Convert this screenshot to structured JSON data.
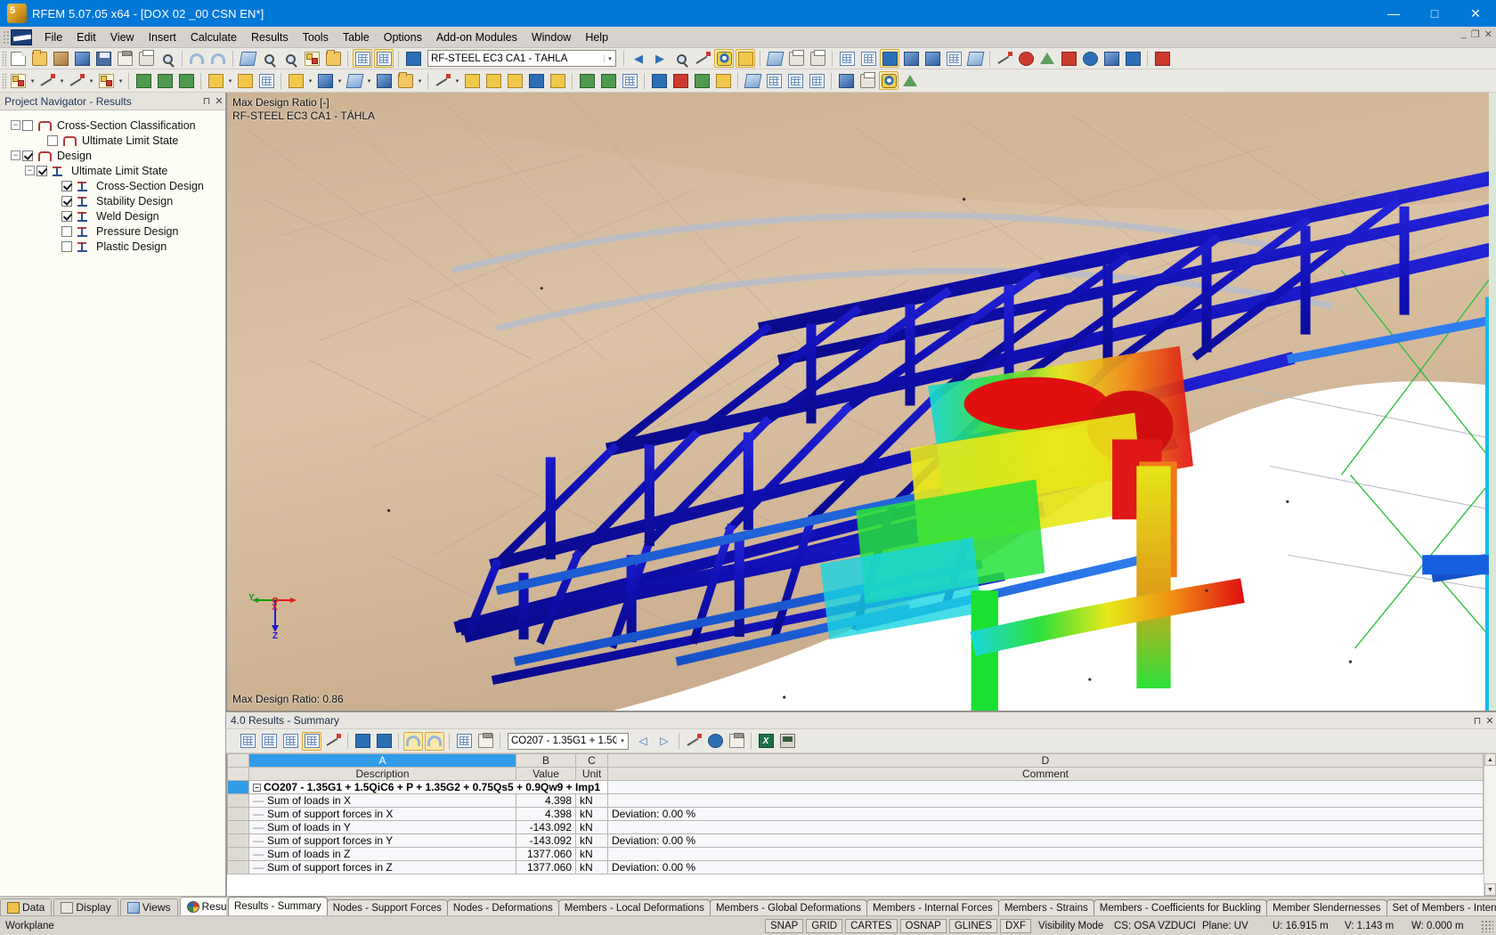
{
  "window": {
    "title": "RFEM 5.07.05 x64 - [DOX 02 _00 CSN EN*]",
    "minimize": "—",
    "maximize": "□",
    "close": "✕",
    "mdi_minimize": "_",
    "mdi_restore": "❐",
    "mdi_close": "✕"
  },
  "menu": [
    {
      "label": "File"
    },
    {
      "label": "Edit"
    },
    {
      "label": "View"
    },
    {
      "label": "Insert"
    },
    {
      "label": "Calculate"
    },
    {
      "label": "Results"
    },
    {
      "label": "Tools"
    },
    {
      "label": "Table"
    },
    {
      "label": "Options"
    },
    {
      "label": "Add-on Modules"
    },
    {
      "label": "Window"
    },
    {
      "label": "Help"
    }
  ],
  "toolbar": {
    "module_combo_value": "RF-STEEL EC3 CA1 - TÁHLA",
    "module_combo_arrow": "▾"
  },
  "navigator": {
    "title": "Project Navigator - Results",
    "pin": "⊓",
    "close": "✕",
    "tree": [
      {
        "label": "Cross-Section Classification",
        "checked": false,
        "icon": "cross-section-icon",
        "level": 0,
        "expander": "−"
      },
      {
        "label": "Ultimate Limit State",
        "checked": false,
        "icon": "cross-section-icon",
        "level": 1,
        "expander": ""
      },
      {
        "label": "Design",
        "checked": true,
        "icon": "cross-section-icon",
        "level": 0,
        "expander": "−"
      },
      {
        "label": "Ultimate Limit State",
        "checked": true,
        "icon": "ibeam-icon",
        "level": 1,
        "expander": "−"
      },
      {
        "label": "Cross-Section Design",
        "checked": true,
        "icon": "ibeam-icon",
        "level": 2,
        "expander": ""
      },
      {
        "label": "Stability Design",
        "checked": true,
        "icon": "ibeam-icon",
        "level": 2,
        "expander": ""
      },
      {
        "label": "Weld Design",
        "checked": true,
        "icon": "ibeam-icon",
        "level": 2,
        "expander": ""
      },
      {
        "label": "Pressure Design",
        "checked": false,
        "icon": "ibeam-icon",
        "level": 2,
        "expander": ""
      },
      {
        "label": "Plastic Design",
        "checked": false,
        "icon": "ibeam-icon",
        "level": 2,
        "expander": ""
      }
    ],
    "tabs": [
      {
        "label": "Data",
        "active": false,
        "icon": "data-icon"
      },
      {
        "label": "Display",
        "active": false,
        "icon": "display-icon"
      },
      {
        "label": "Views",
        "active": false,
        "icon": "views-icon"
      },
      {
        "label": "Results",
        "active": true,
        "icon": "results-icon"
      }
    ]
  },
  "viewport": {
    "label_line1": "Max Design Ratio [-]",
    "label_line2": "RF-STEEL EC3 CA1 - TÁHLA",
    "footer": "Max Design Ratio: 0.86",
    "axis_x": "X",
    "axis_y": "Y",
    "axis_z": "Z",
    "axis_x_color": "#e01b1b",
    "axis_y_color": "#09a009",
    "axis_z_color": "#1a1ad0"
  },
  "results_panel": {
    "title": "4.0 Results - Summary",
    "pin": "⊓",
    "close": "✕",
    "combo_value": "CO207 - 1.35G1 + 1.5C",
    "combo_arrow": "▾",
    "prev_arrow": "◁",
    "next_arrow": "▷",
    "columns": [
      {
        "letter": "A",
        "name": "Description",
        "selected": true
      },
      {
        "letter": "B",
        "name": "Value",
        "selected": false
      },
      {
        "letter": "C",
        "name": "Unit",
        "selected": false
      },
      {
        "letter": "D",
        "name": "Comment",
        "selected": false
      }
    ],
    "rows": [
      {
        "type": "group",
        "description": "CO207 - 1.35G1 + 1.5QiC6 + P + 1.35G2 + 0.75Qs5 + 0.9Qw9 + Imp1",
        "value": "",
        "unit": "",
        "comment": "",
        "expander": "−",
        "selected": true
      },
      {
        "type": "item",
        "description": "Sum of loads in X",
        "value": "4.398",
        "unit": "kN",
        "comment": ""
      },
      {
        "type": "item",
        "description": "Sum of support forces in X",
        "value": "4.398",
        "unit": "kN",
        "comment": "Deviation:  0.00 %"
      },
      {
        "type": "item",
        "description": "Sum of loads in Y",
        "value": "-143.092",
        "unit": "kN",
        "comment": ""
      },
      {
        "type": "item",
        "description": "Sum of support forces in Y",
        "value": "-143.092",
        "unit": "kN",
        "comment": "Deviation:  0.00 %"
      },
      {
        "type": "item",
        "description": "Sum of loads in Z",
        "value": "1377.060",
        "unit": "kN",
        "comment": ""
      },
      {
        "type": "item",
        "description": "Sum of support forces in Z",
        "value": "1377.060",
        "unit": "kN",
        "comment": "Deviation:  0.00 %"
      }
    ],
    "tabs": [
      {
        "label": "Results - Summary",
        "active": true
      },
      {
        "label": "Nodes - Support Forces",
        "active": false
      },
      {
        "label": "Nodes - Deformations",
        "active": false
      },
      {
        "label": "Members - Local Deformations",
        "active": false
      },
      {
        "label": "Members - Global Deformations",
        "active": false
      },
      {
        "label": "Members - Internal Forces",
        "active": false
      },
      {
        "label": "Members - Strains",
        "active": false
      },
      {
        "label": "Members - Coefficients for Buckling",
        "active": false
      },
      {
        "label": "Member Slendernesses",
        "active": false
      },
      {
        "label": "Set of Members - Internal Forces",
        "active": false
      }
    ],
    "tab_nav": [
      "|◀",
      "◀",
      "▶",
      "▶|"
    ]
  },
  "workplane": {
    "label": "Workplane"
  },
  "statusbar": {
    "toggles": [
      "SNAP",
      "GRID",
      "CARTES",
      "OSNAP",
      "GLINES",
      "DXF"
    ],
    "visibility_mode": "Visibility Mode",
    "cs": "CS: OSA VZDUCH",
    "plane": "Plane: UV",
    "u": "U:  16.915 m",
    "v": "V:  1.143 m",
    "w": "W:  0.000 m"
  }
}
